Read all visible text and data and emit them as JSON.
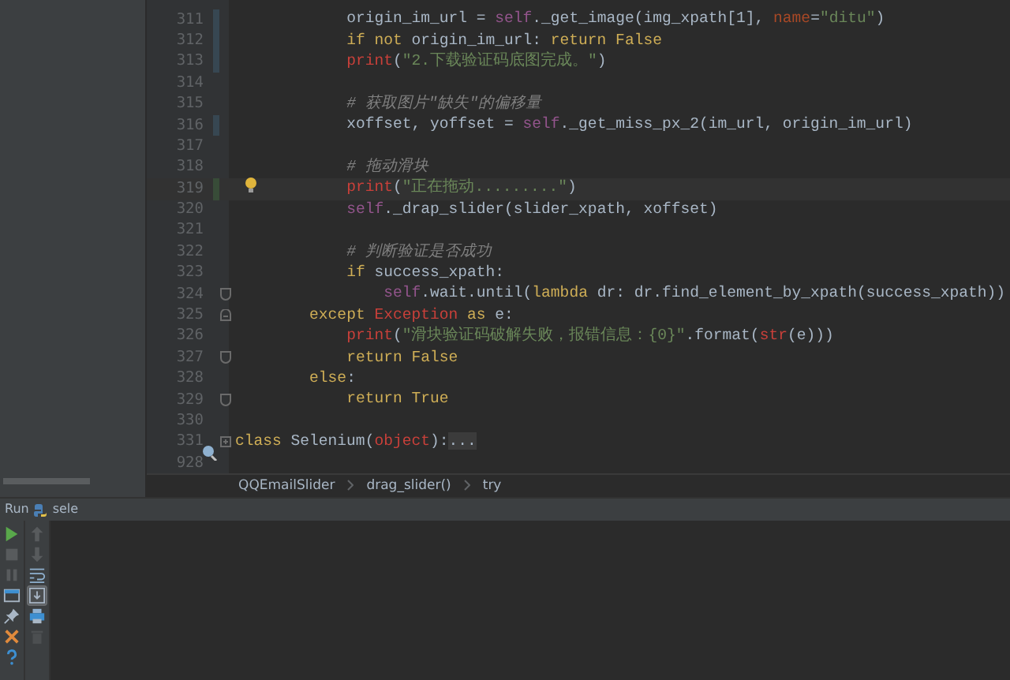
{
  "editor": {
    "lines": [
      {
        "number": "311",
        "modified": true,
        "tokens": [
          {
            "kind": "plain",
            "text": "            origin_im_url = "
          },
          {
            "kind": "self",
            "text": "self"
          },
          {
            "kind": "plain",
            "text": "._get_image(img_xpath[1], "
          },
          {
            "kind": "param",
            "text": "name"
          },
          {
            "kind": "plain",
            "text": "="
          },
          {
            "kind": "str",
            "text": "\"ditu\""
          },
          {
            "kind": "plain",
            "text": ")"
          }
        ]
      },
      {
        "number": "312",
        "modified": true,
        "tokens": [
          {
            "kind": "kw",
            "text": "            if not "
          },
          {
            "kind": "plain",
            "text": "origin_im_url: "
          },
          {
            "kind": "kw",
            "text": "return False"
          }
        ]
      },
      {
        "number": "313",
        "modified": true,
        "tokens": [
          {
            "kind": "builtin",
            "text": "            print"
          },
          {
            "kind": "plain",
            "text": "("
          },
          {
            "kind": "str",
            "text": "\"2.下载验证码底图完成。\""
          },
          {
            "kind": "plain",
            "text": ")"
          }
        ]
      },
      {
        "number": "314"
      },
      {
        "number": "315",
        "tokens": [
          {
            "kind": "comment",
            "text": "            # 获取图片\"缺失\"的偏移量"
          }
        ]
      },
      {
        "number": "316",
        "modified": true,
        "tokens": [
          {
            "kind": "plain",
            "text": "            xoffset, yoffset = "
          },
          {
            "kind": "self",
            "text": "self"
          },
          {
            "kind": "plain",
            "text": "._get_miss_px_2(im_url, origin_im_url)"
          }
        ]
      },
      {
        "number": "317"
      },
      {
        "number": "318",
        "tokens": [
          {
            "kind": "comment",
            "text": "            # 拖动滑块"
          }
        ]
      },
      {
        "number": "319",
        "added": true,
        "current": true,
        "hint": true,
        "tokens": [
          {
            "kind": "builtin",
            "text": "            print"
          },
          {
            "kind": "plain",
            "text": "("
          },
          {
            "kind": "str",
            "text": "\"正在拖动.........\""
          },
          {
            "kind": "plain",
            "text": ")"
          }
        ]
      },
      {
        "number": "320",
        "tokens": [
          {
            "kind": "self",
            "text": "            self"
          },
          {
            "kind": "plain",
            "text": "._drap_slider(slider_xpath, xoffset)"
          }
        ]
      },
      {
        "number": "321"
      },
      {
        "number": "322",
        "tokens": [
          {
            "kind": "comment",
            "text": "            # 判断验证是否成功"
          }
        ]
      },
      {
        "number": "323",
        "tokens": [
          {
            "kind": "kw",
            "text": "            if "
          },
          {
            "kind": "plain",
            "text": "success_xpath:"
          }
        ]
      },
      {
        "number": "324",
        "fold_end": true,
        "tokens": [
          {
            "kind": "self",
            "text": "                self"
          },
          {
            "kind": "plain",
            "text": ".wait.until("
          },
          {
            "kind": "kw",
            "text": "lambda"
          },
          {
            "kind": "plain",
            "text": " dr: dr.find_element_by_xpath(success_xpath))"
          }
        ]
      },
      {
        "number": "325",
        "fold_start": true,
        "tokens": [
          {
            "kind": "kw",
            "text": "        except "
          },
          {
            "kind": "builtin",
            "text": "Exception"
          },
          {
            "kind": "kw",
            "text": " as "
          },
          {
            "kind": "plain",
            "text": "e:"
          }
        ]
      },
      {
        "number": "326",
        "tokens": [
          {
            "kind": "builtin",
            "text": "            print"
          },
          {
            "kind": "plain",
            "text": "("
          },
          {
            "kind": "str",
            "text": "\"滑块验证码破解失败，报错信息：{0}\""
          },
          {
            "kind": "plain",
            "text": ".format("
          },
          {
            "kind": "builtin",
            "text": "str"
          },
          {
            "kind": "plain",
            "text": "(e)))"
          }
        ]
      },
      {
        "number": "327",
        "fold_end": true,
        "tokens": [
          {
            "kind": "kw",
            "text": "            return False"
          }
        ]
      },
      {
        "number": "328",
        "tokens": [
          {
            "kind": "kw",
            "text": "        else"
          },
          {
            "kind": "plain",
            "text": ":"
          }
        ]
      },
      {
        "number": "329",
        "fold_end": true,
        "tokens": [
          {
            "kind": "kw",
            "text": "            return True"
          }
        ]
      },
      {
        "number": "330"
      },
      {
        "number": "331",
        "collapsed": true,
        "overridden": true,
        "tokens": [
          {
            "kind": "kw",
            "text": "class "
          },
          {
            "kind": "plain",
            "text": "Selenium("
          },
          {
            "kind": "builtin",
            "text": "object"
          },
          {
            "kind": "plain",
            "text": "):"
          },
          {
            "kind": "folded",
            "text": "..."
          }
        ]
      },
      {
        "number": "928"
      }
    ]
  },
  "breadcrumbs": [
    "QQEmailSlider",
    "drag_slider()",
    "try"
  ],
  "run_panel": {
    "label": "Run",
    "config": "sele",
    "tools_left": [
      {
        "kind": "run",
        "disabled": false
      },
      {
        "kind": "stop",
        "disabled": true
      },
      {
        "kind": "pause",
        "disabled": true
      },
      {
        "kind": "layout",
        "disabled": false
      },
      {
        "kind": "pin",
        "disabled": false
      },
      {
        "kind": "close",
        "disabled": false
      },
      {
        "kind": "help",
        "disabled": false
      }
    ],
    "tools_right": [
      {
        "kind": "up",
        "disabled": true,
        "selected": false
      },
      {
        "kind": "down",
        "disabled": true,
        "selected": false
      },
      {
        "kind": "wrap",
        "disabled": false,
        "selected": false
      },
      {
        "kind": "scroll-end",
        "disabled": false,
        "selected": true
      },
      {
        "kind": "print",
        "disabled": false,
        "selected": false
      },
      {
        "kind": "trash",
        "disabled": true,
        "selected": false
      }
    ]
  }
}
